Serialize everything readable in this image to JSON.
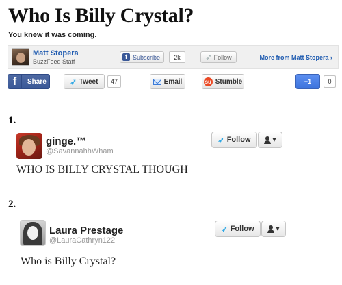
{
  "article": {
    "title": "Who Is Billy Crystal?",
    "subtitle": "You knew it was coming."
  },
  "author": {
    "name": "Matt Stopera",
    "role": "BuzzFeed Staff",
    "subscribe_label": "Subscribe",
    "subscribe_count": "2k",
    "follow_label": "Follow",
    "more_from": "More from Matt Stopera ›"
  },
  "share": {
    "facebook_label": "Share",
    "tweet_label": "Tweet",
    "tweet_count": "47",
    "email_label": "Email",
    "stumble_label": "Stumble",
    "gplus_label": "+1",
    "gplus_count": "0"
  },
  "tweets": [
    {
      "number": "1.",
      "name": "ginge.™",
      "handle": "@SavannahhWham",
      "text": "WHO IS BILLY CRYSTAL THOUGH",
      "follow_label": "Follow"
    },
    {
      "number": "2.",
      "name": "Laura Prestage",
      "handle": "@LauraCathryn122",
      "text": "Who is Billy Crystal?",
      "follow_label": "Follow"
    }
  ],
  "colors": {
    "link_blue": "#1f5bb0",
    "facebook_blue": "#3b5998",
    "twitter_blue": "#2ea8e5",
    "stumble_red": "#eb4924",
    "gplus_blue": "#3d74dd"
  },
  "icons": [
    "facebook-icon",
    "twitter-bird-icon",
    "email-icon",
    "stumbleupon-icon",
    "user-icon",
    "caret-down-icon"
  ]
}
